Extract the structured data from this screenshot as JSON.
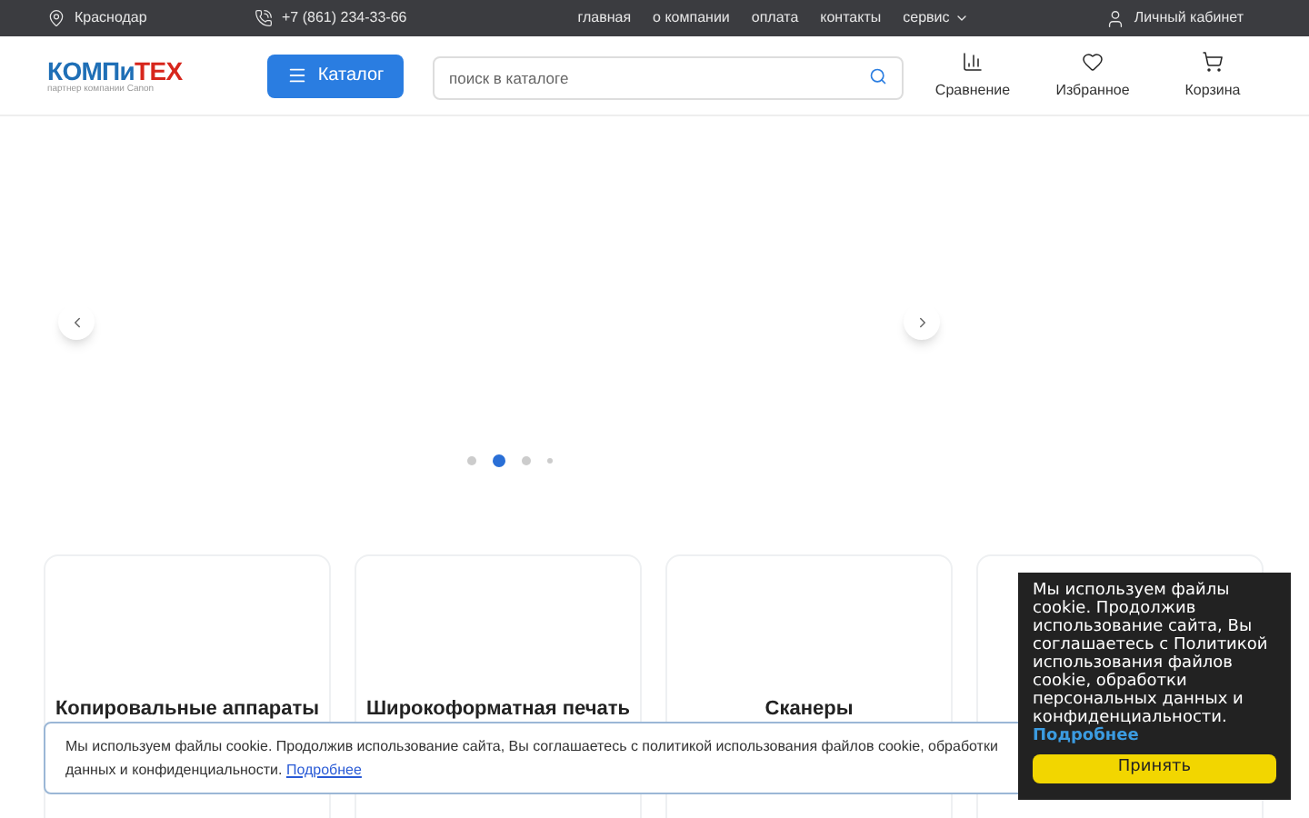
{
  "top_bar": {
    "city": "Краснодар",
    "phone": "+7 (861) 234-33-66",
    "nav": [
      "главная",
      "о компании",
      "оплата",
      "контакты"
    ],
    "service_menu": "сервис",
    "account": "Личный кабинет"
  },
  "header": {
    "logo": {
      "part_1": "КОМПи",
      "part_2": "ТЕХ",
      "tagline": "партнер компании Canon"
    },
    "catalog_button": "Каталог",
    "search": {
      "placeholder": "поиск в каталоге"
    },
    "actions": [
      {
        "kind": "compare",
        "label": "Сравнение"
      },
      {
        "kind": "favorites",
        "label": "Избранное"
      },
      {
        "kind": "cart",
        "label": "Корзина"
      }
    ]
  },
  "slider": {
    "dots": [
      {
        "selected": false
      },
      {
        "selected": true
      },
      {
        "selected": false
      },
      {
        "selected": false
      }
    ]
  },
  "categories": [
    {
      "kind": "titled",
      "title": "Копировальные аппараты"
    },
    {
      "kind": "titled",
      "title": "Широкоформатная печать"
    },
    {
      "kind": "titled",
      "title": "Сканеры"
    },
    {
      "kind": "covered"
    }
  ],
  "cookie_banner": {
    "line_1": "Мы используем файлы cookie. Продолжив использование сайта, Вы соглашаетесь с политикой использования файлов cookie, обработки",
    "line_2": "данных и конфиденциальности.",
    "link": "Подробнее"
  },
  "cookie_popup": {
    "text": "Мы используем файлы cookie. Продолжив использование сайта, Вы соглашаетесь с Политикой использования файлов cookie, обработки персональных данных и конфиденциальности.",
    "link": "Подробнее",
    "button": "Принять"
  }
}
